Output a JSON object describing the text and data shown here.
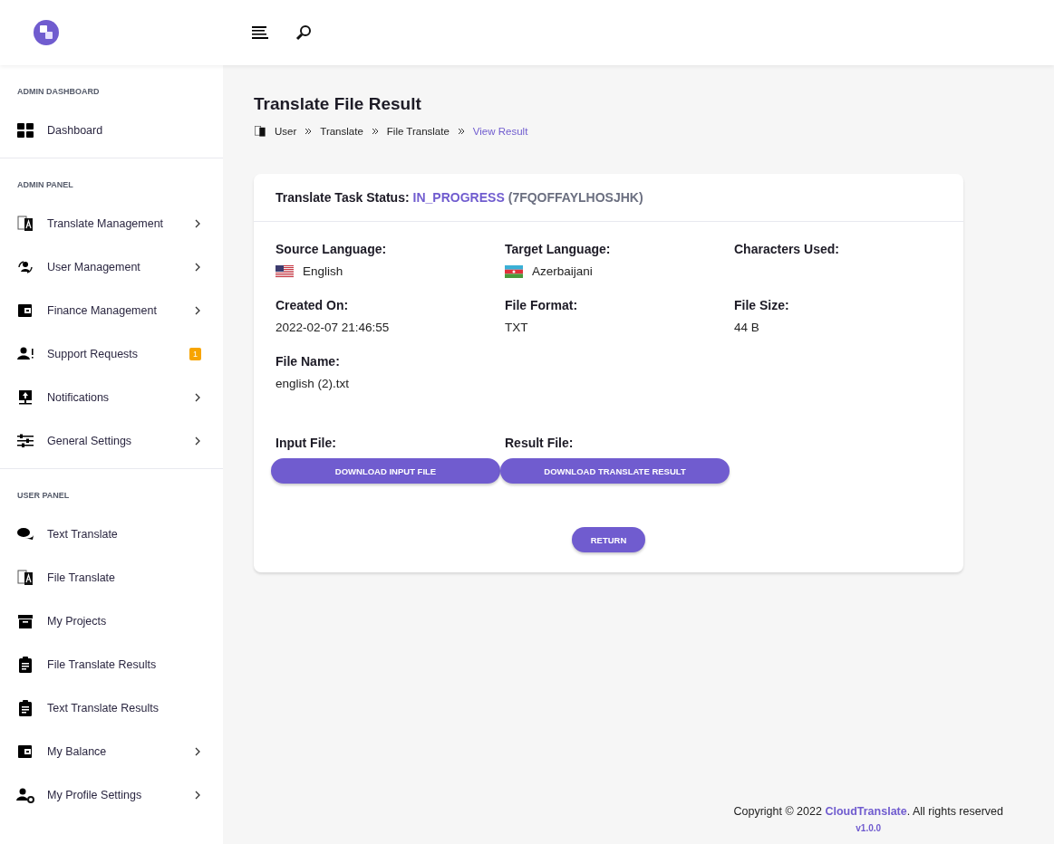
{
  "sidebar": {
    "sections": [
      {
        "title": "ADMIN DASHBOARD",
        "items": [
          {
            "label": "Dashboard",
            "kind": "link"
          }
        ]
      },
      {
        "title": "ADMIN PANEL",
        "items": [
          {
            "label": "Translate Management",
            "kind": "submenu"
          },
          {
            "label": "User Management",
            "kind": "submenu"
          },
          {
            "label": "Finance Management",
            "kind": "submenu"
          },
          {
            "label": "Support Requests",
            "kind": "badge",
            "badge": "1"
          },
          {
            "label": "Notifications",
            "kind": "submenu"
          },
          {
            "label": "General Settings",
            "kind": "submenu"
          }
        ]
      },
      {
        "title": "USER PANEL",
        "items": [
          {
            "label": "Text Translate",
            "kind": "link"
          },
          {
            "label": "File Translate",
            "kind": "link"
          },
          {
            "label": "My Projects",
            "kind": "link"
          },
          {
            "label": "File Translate Results",
            "kind": "link"
          },
          {
            "label": "Text Translate Results",
            "kind": "link"
          },
          {
            "label": "My Balance",
            "kind": "submenu"
          },
          {
            "label": "My Profile Settings",
            "kind": "submenu"
          }
        ]
      }
    ]
  },
  "page": {
    "title": "Translate File Result",
    "breadcrumb": [
      {
        "label": "User",
        "selected": false
      },
      {
        "label": "Translate",
        "selected": false
      },
      {
        "label": "File Translate",
        "selected": false
      },
      {
        "label": "View Result",
        "selected": true
      }
    ]
  },
  "card": {
    "status_label": "Translate Task Status:",
    "status": "IN_PROGRESS",
    "task_id": "(7FQOFFAYLHOSJHK)",
    "fields": [
      {
        "label": "Source Language:",
        "value": "English",
        "kind": "flag"
      },
      {
        "label": "Target Language:",
        "value": "Azerbaijani",
        "kind": "flag"
      },
      {
        "label": "Characters Used:",
        "kind": "plain"
      },
      {
        "label": "Created On:",
        "value": "2022-02-07 21:46:55",
        "kind": "plain"
      },
      {
        "label": "File Format:",
        "value": "TXT",
        "kind": "plain"
      },
      {
        "label": "File Size:",
        "value": "44 B",
        "kind": "plain"
      },
      {
        "label": "File Name:",
        "value": "english (2).txt",
        "kind": "plain"
      }
    ],
    "downloads": [
      {
        "label": "Input File:",
        "button": "DOWNLOAD INPUT FILE"
      },
      {
        "label": "Result File:",
        "button": "DOWNLOAD TRANSLATE RESULT"
      }
    ],
    "return_button": "RETURN"
  },
  "footer": {
    "before": "Copyright © 2022",
    "brand": "CloudTranslate",
    "after": ". All rights reserved",
    "version": "v1.0.0"
  }
}
